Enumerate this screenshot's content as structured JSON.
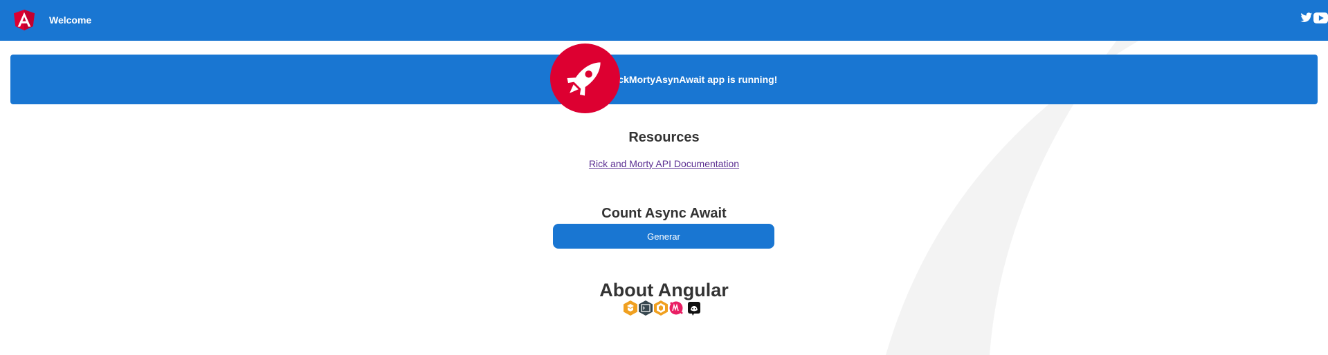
{
  "header": {
    "title": "Welcome",
    "logo_icon": "angular-logo-icon",
    "social_icons": [
      "twitter-icon",
      "youtube-icon"
    ]
  },
  "status_card": {
    "message": "rickMortyAsynAwait app is running!",
    "icon": "rocket-icon"
  },
  "resources": {
    "title": "Resources",
    "link_label": "Rick and Morty API Documentation"
  },
  "counter": {
    "title": "Count Async Await",
    "button_label": "Generar"
  },
  "about": {
    "title": "About Angular",
    "icons": [
      "angular-learn-icon",
      "cli-icon",
      "material-icon",
      "meetup-icon",
      "discord-icon"
    ]
  },
  "colors": {
    "primary": "#1976d2",
    "accent": "#dd0031",
    "link": "#5a2d91"
  }
}
